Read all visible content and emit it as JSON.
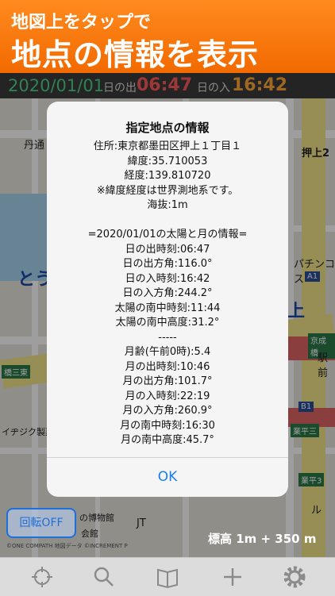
{
  "banner": {
    "line1": "地図上をタップで",
    "line2": "地点の情報を表示"
  },
  "sunbar": {
    "date": "2020/01/01",
    "rise_label": "日の出",
    "rise_time": "06:47",
    "set_label": "日の入",
    "set_time": "16:42"
  },
  "map_labels": [
    "丹通",
    "押上2",
    "パチンコス",
    "A1",
    "京成橋",
    "駅前",
    "B1",
    "業平三",
    "業平3",
    "とう",
    "橋三東",
    "イヂジク製菓",
    "上",
    "JT",
    "の博物館",
    "会館",
    "ル",
    "業平",
    "押上"
  ],
  "dialog": {
    "title": "指定地点の情報",
    "lines": [
      "住所:東京都墨田区押上１丁目１",
      "緯度:35.710053",
      "経度:139.810720",
      "※緯度経度は世界測地系です。",
      "海抜:1m",
      "",
      "=2020/01/01の太陽と月の情報=",
      "日の出時刻:06:47",
      "日の出方角:116.0°",
      "日の入時刻:16:42",
      "日の入方角:244.2°",
      "太陽の南中時刻:11:44",
      "太陽の南中高度:31.2°",
      "-----",
      "月齢(午前0時):5.4",
      "月の出時刻:10:46",
      "月の出方角:101.7°",
      "月の入時刻:22:19",
      "月の入方角:260.9°",
      "月の南中時刻:16:30",
      "月の南中高度:45.7°"
    ],
    "ok_label": "OK"
  },
  "rotate_button": "回転OFF",
  "copyright": "©ONE COMPATH 地図データ ©INCREMENT P",
  "elevation": "標高 1m + 350 m",
  "toolbar": [
    "crosshair-icon",
    "search-icon",
    "book-icon",
    "plus-icon",
    "gear-icon"
  ]
}
